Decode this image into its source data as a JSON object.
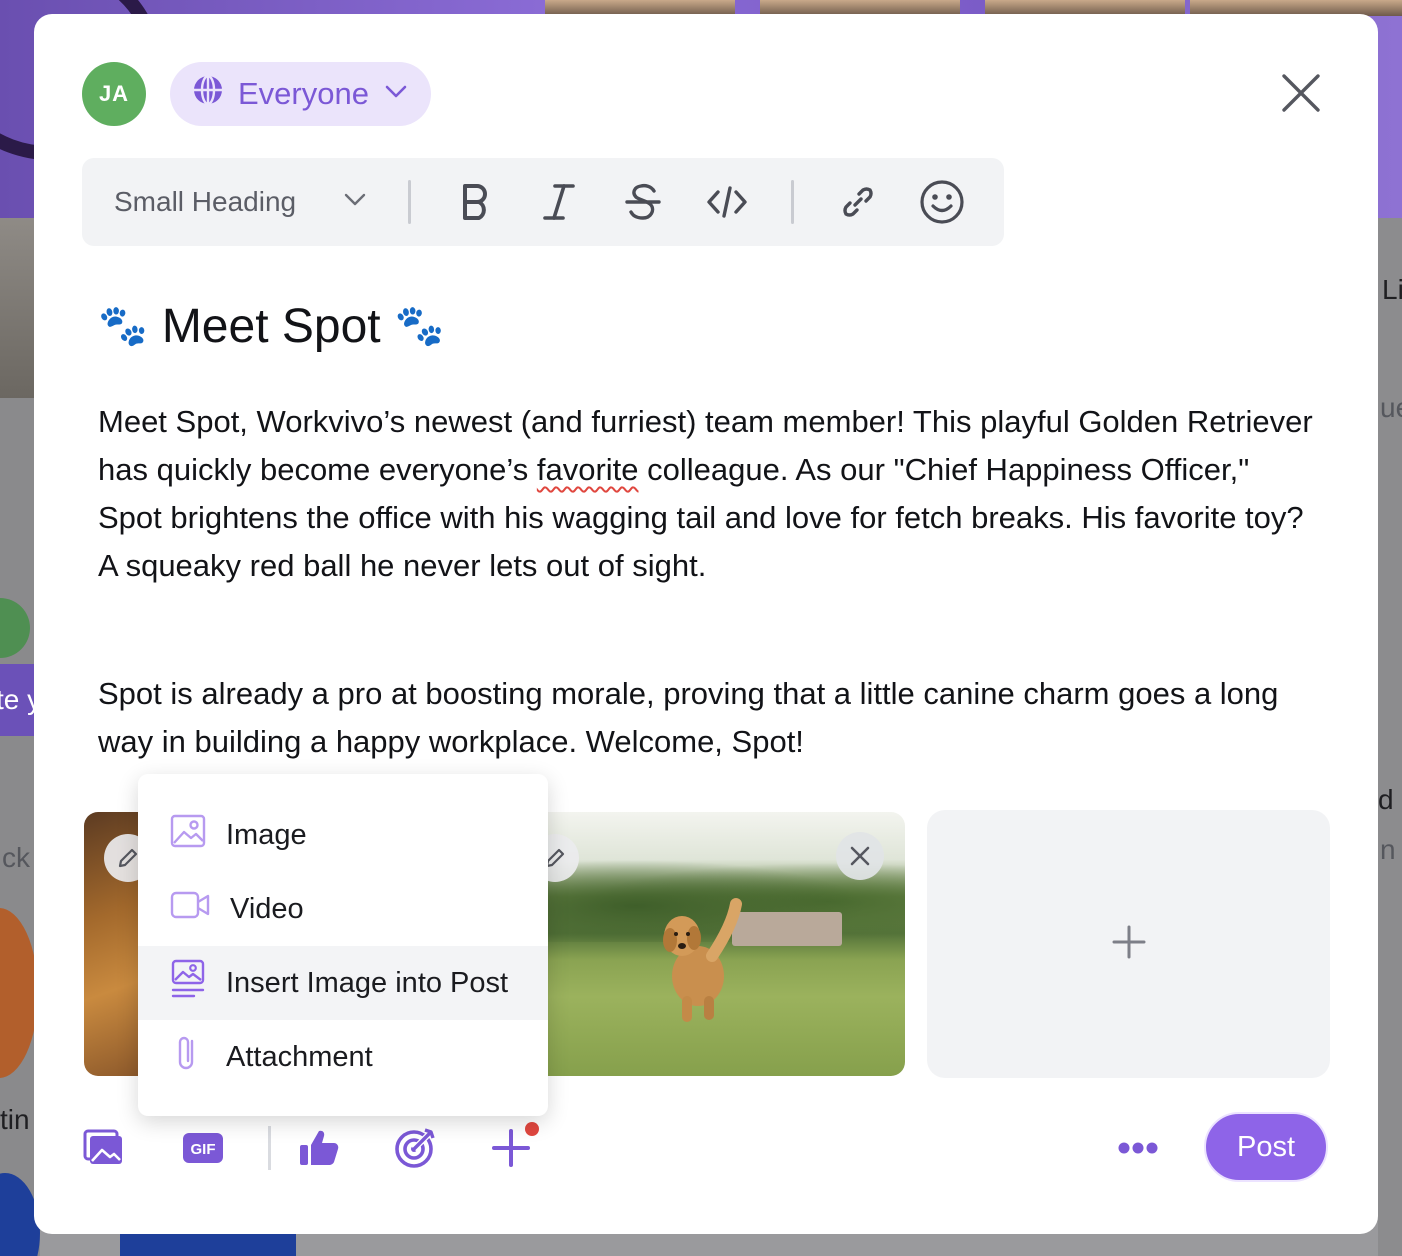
{
  "composer": {
    "avatar_initials": "JA",
    "audience_label": "Everyone",
    "text_style": "Small Heading",
    "post_title": "Meet Spot",
    "title_emoji": "🐾",
    "paragraph_1": {
      "before": "Meet Spot, Workvivo’s newest (and furriest) team member! This playful Golden Retriever has quickly become everyone’s ",
      "flagged_word": "favorite",
      "after": " colleague. As our \"Chief Happiness Officer,\" Spot brightens the office with his wagging tail and love for fetch breaks. His favorite toy? A squeaky red ball he never lets out of sight."
    },
    "paragraph_2": "Spot is already a pro at boosting morale, proving that a little canine charm goes a long way in building a happy workplace. Welcome, Spot!",
    "post_button": "Post"
  },
  "insert_menu": {
    "items": [
      {
        "label": "Image",
        "icon": "image-icon"
      },
      {
        "label": "Video",
        "icon": "video-icon"
      },
      {
        "label": "Insert Image into Post",
        "icon": "inline-image-icon",
        "highlighted": true
      },
      {
        "label": "Attachment",
        "icon": "paperclip-icon"
      }
    ]
  },
  "background": {
    "fragments": [
      "Li",
      "ue",
      "te y",
      "ck",
      "d",
      "n",
      "tin"
    ]
  },
  "colors": {
    "accent": "#8e64e8",
    "audience_bg": "#ebe4fb",
    "avatar": "#5fae5f",
    "notification_dot": "#e0473f",
    "toolbar_bg": "#f2f3f5"
  }
}
